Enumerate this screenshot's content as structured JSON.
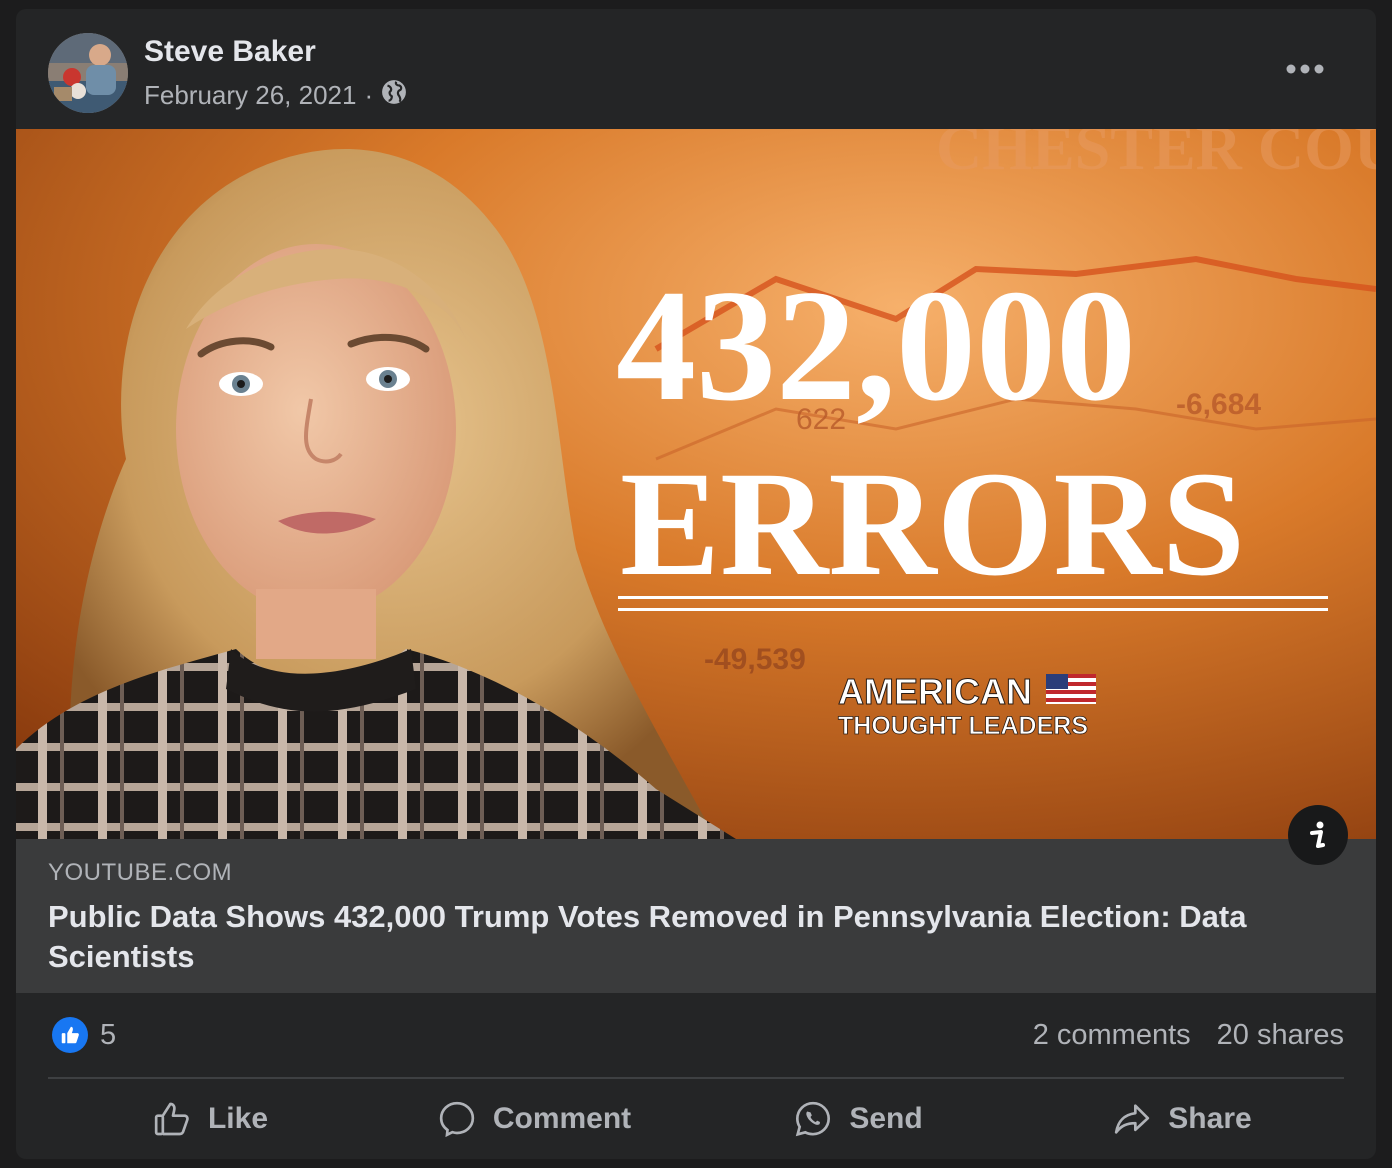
{
  "post": {
    "author": "Steve Baker",
    "date": "February 26, 2021",
    "separator": "·",
    "audience_icon": "globe-icon",
    "more_icon": "more-horizontal-icon"
  },
  "thumbnail": {
    "overlay_text": {
      "headline_number": "432,000",
      "headline_word": "ERRORS",
      "bg_text": "CHESTER COU",
      "chart_numbers": [
        "-6,684",
        "-49,539",
        "622"
      ],
      "brand_line1": "AMERICAN",
      "brand_line2": "THOUGHT LEADERS"
    },
    "info_icon": "info-icon"
  },
  "link_preview": {
    "domain": "YOUTUBE.COM",
    "title": "Public Data Shows 432,000 Trump Votes Removed in Pennsylvania Election: Data Scientists"
  },
  "stats": {
    "reaction_icon": "thumbs-up-icon",
    "reaction_count": "5",
    "comments": "2 comments",
    "shares": "20 shares"
  },
  "actions": {
    "like": "Like",
    "comment": "Comment",
    "send": "Send",
    "share": "Share"
  },
  "colors": {
    "card_bg": "#242526",
    "preview_bg": "#3a3b3c",
    "like_blue": "#1877f2",
    "text_secondary": "#b0b3b8"
  }
}
